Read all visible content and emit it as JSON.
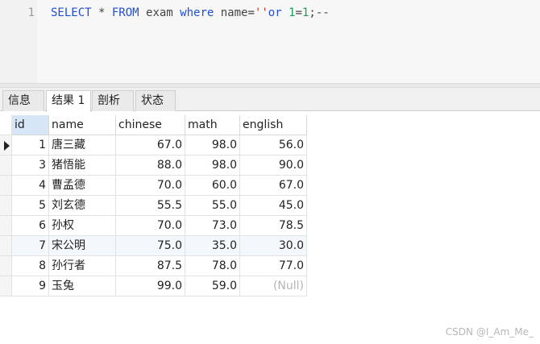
{
  "editor": {
    "line_number": "1",
    "sql": {
      "select": "SELECT",
      "star": " * ",
      "from": "FROM",
      "table": " exam ",
      "where": "where",
      "name_eq": " name=",
      "quotes": "''",
      "or": "or",
      "one_a": " 1",
      "eq": "=",
      "one_b": "1",
      "tail": ";--"
    }
  },
  "tabs": {
    "info": "信息",
    "result": "结果 1",
    "profile": "剖析",
    "status": "状态"
  },
  "table": {
    "columns": [
      "id",
      "name",
      "chinese",
      "math",
      "english"
    ],
    "rows": [
      [
        "1",
        "唐三藏",
        "67.0",
        "98.0",
        "56.0"
      ],
      [
        "3",
        "猪悟能",
        "88.0",
        "98.0",
        "90.0"
      ],
      [
        "4",
        "曹孟德",
        "70.0",
        "60.0",
        "67.0"
      ],
      [
        "5",
        "刘玄德",
        "55.5",
        "55.0",
        "45.0"
      ],
      [
        "6",
        "孙权",
        "70.0",
        "73.0",
        "78.5"
      ],
      [
        "7",
        "宋公明",
        "75.0",
        "35.0",
        "30.0"
      ],
      [
        "8",
        "孙行者",
        "87.5",
        "78.0",
        "77.0"
      ],
      [
        "9",
        "玉兔",
        "99.0",
        "59.0",
        "(Null)"
      ]
    ]
  },
  "watermark": "CSDN @I_Am_Me_"
}
